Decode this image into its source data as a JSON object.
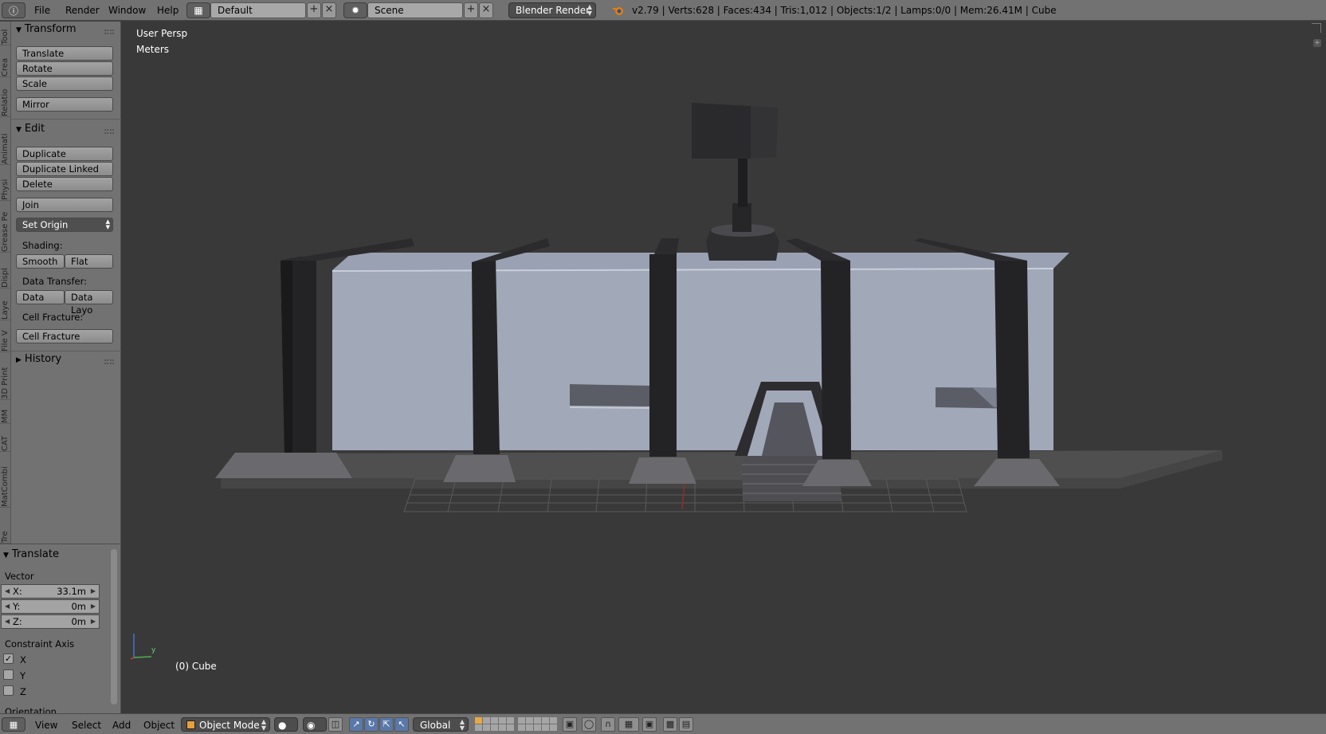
{
  "header": {
    "menus": [
      "File",
      "Render",
      "Window",
      "Help"
    ],
    "layout": "Default",
    "scene": "Scene",
    "engine": "Blender Render",
    "info": "v2.79 | Verts:628 | Faces:434 | Tris:1,012 | Objects:1/2 | Lamps:0/0 | Mem:26.41M | Cube"
  },
  "tabs": [
    "Tool",
    "Crea",
    "Relatio",
    "Animati",
    "Physi",
    "Grease Pe",
    "Displ",
    "Laye",
    "File V",
    "3D Print",
    "MM",
    "CAT",
    "MatCombi",
    "Tre"
  ],
  "toolshelf": {
    "transform": {
      "title": "Transform",
      "buttons": [
        "Translate",
        "Rotate",
        "Scale",
        "Mirror"
      ]
    },
    "edit": {
      "title": "Edit",
      "buttons": [
        "Duplicate",
        "Duplicate Linked",
        "Delete",
        "Join"
      ],
      "set_origin": "Set Origin",
      "shading_label": "Shading:",
      "smooth": "Smooth",
      "flat": "Flat",
      "data_transfer_label": "Data Transfer:",
      "data": "Data",
      "data_layout": "Data Layo",
      "cell_fracture_label": "Cell Fracture:",
      "cell_fracture": "Cell Fracture"
    },
    "history": {
      "title": "History"
    }
  },
  "operator": {
    "title": "Translate",
    "vector_label": "Vector",
    "fields": [
      {
        "label": "X:",
        "value": "33.1m"
      },
      {
        "label": "Y:",
        "value": "0m"
      },
      {
        "label": "Z:",
        "value": "0m"
      }
    ],
    "constraint_label": "Constraint Axis",
    "constraints": [
      {
        "label": "X",
        "checked": true
      },
      {
        "label": "Y",
        "checked": false
      },
      {
        "label": "Z",
        "checked": false
      }
    ],
    "orientation_label": "Orientation"
  },
  "viewport": {
    "view_name": "User Persp",
    "units": "Meters",
    "object_label": "(0) Cube",
    "axis_y": "y"
  },
  "footer": {
    "menus": [
      "View",
      "Select",
      "Add",
      "Object"
    ],
    "mode": "Object Mode",
    "orientation": "Global"
  }
}
